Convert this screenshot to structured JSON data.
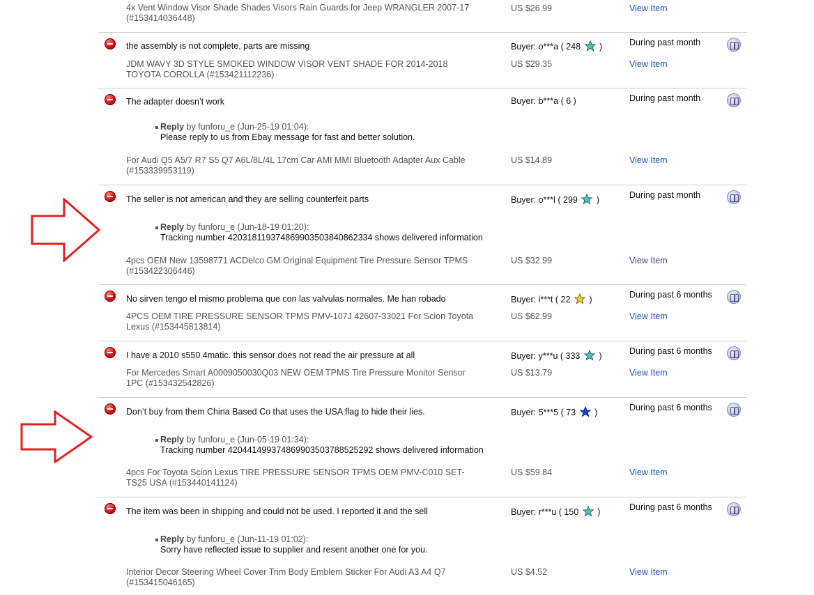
{
  "rows": [
    {
      "comment": "",
      "buyer": "",
      "period": "",
      "item_title_line1": "4x Vent Window Visor Shade Shades Visors Rain Guards for Jeep WRANGLER 2007-17",
      "item_title_line2": "(#153414036448)",
      "price": "US $26.99",
      "view": "View Item"
    },
    {
      "comment": "the assembly is not complete, parts are missing",
      "buyer_prefix": "Buyer: o***a ( 248",
      "buyer_suffix": ")",
      "star_color": "#40c8b8",
      "period": "During past month",
      "item_title_line1": "JDM WAVY 3D STYLE SMOKED WINDOW VISOR VENT SHADE FOR 2014-2018",
      "item_title_line2": "TOYOTA COROLLA (#153421112236)",
      "price": "US $29.35",
      "view": "View Item"
    },
    {
      "comment": "The adapter doesn’t work",
      "buyer_prefix": "Buyer: b***a ( 6 )",
      "period": "During past month",
      "reply_label": "Reply",
      "reply_meta": " by funforu_e (Jun-25-19 01:04):",
      "reply_text": "Please reply to us from Ebay message for fast and better solution.",
      "item_title_line1": "For Audi Q5 A5/7 R7 S5 Q7 A6L/8L/4L 17cm Car AMI MMI Bluetooth Adapter Aux Cable",
      "item_title_line2": "(#153339953119)",
      "price": "US $14.89",
      "view": "View Item"
    },
    {
      "comment": "The seller is not american and they are selling counterfeit parts",
      "buyer_prefix": "Buyer: o***l ( 299",
      "buyer_suffix": ")",
      "star_color": "#40c8b8",
      "period": "During past month",
      "reply_label": "Reply",
      "reply_meta": " by funforu_e (Jun-18-19 01:20):",
      "reply_text": "Tracking number 420318119374869903503840862334 shows delivered information",
      "item_title_line1": "4pcs OEM New 13598771 ACDelco GM Original Equipment Tire Pressure Sensor TPMS",
      "item_title_line2": "(#153422306446)",
      "price": "US $32.99",
      "view": "View Item"
    },
    {
      "comment": "No sirven tengo el mismo problema que con las valvulas normales. Me han robado",
      "buyer_prefix": "Buyer: i***t ( 22",
      "buyer_suffix": ")",
      "star_color": "#f2d21b",
      "period": "During past 6 months",
      "item_title_line1": "4PCS OEM TIRE PRESSURE SENSOR TPMS PMV-107J 42607-33021 For Scion Toyota",
      "item_title_line2": "Lexus (#153445813814)",
      "price": "US $62.99",
      "view": "View Item"
    },
    {
      "comment": "I have a 2010 s550 4matic. this sensor does not read the air pressure at all",
      "buyer_prefix": "Buyer: y***u ( 333",
      "buyer_suffix": ")",
      "star_color": "#40c8b8",
      "period": "During past 6 months",
      "item_title_line1": "For Mercedes Smart A0009050030Q03 NEW OEM TPMS Tire Pressure Monitor Sensor",
      "item_title_line2": "1PC (#153432542826)",
      "price": "US $13.79",
      "view": "View Item"
    },
    {
      "comment": "Don’t buy from them China Based Co that uses the USA flag to hide their lies.",
      "buyer_prefix": "Buyer: 5***5 ( 73",
      "buyer_suffix": ")",
      "star_color": "#1f3fd6",
      "period": "During past 6 months",
      "reply_label": "Reply",
      "reply_meta": " by funforu_e (Jun-05-19 01:34):",
      "reply_text": "Tracking number 420441499374869903503788525292 shows delivered information",
      "item_title_line1": "4pcs For Toyota Scion Lexus TIRE PRESSURE SENSOR TPMS OEM PMV-C010 SET-",
      "item_title_line2": "TS25 USA (#153440141124)",
      "price": "US $59.84",
      "view": "View Item"
    },
    {
      "comment": "The item was been in shipping and could not be used. I reported it and the sell",
      "buyer_prefix": "Buyer: r***u ( 150",
      "buyer_suffix": ")",
      "star_color": "#40c8b8",
      "period": "During past 6 months",
      "reply_label": "Reply",
      "reply_meta": " by funforu_e (Jun-11-19 01:02):",
      "reply_text": "Sorry have reflected issue to supplier and resent another one for you.",
      "item_title_line1": "Interior Decor Steering Wheel Cover Trim Body Emblem Sticker For Audi A3 A4 Q7",
      "item_title_line2": "(#153415046165)",
      "price": "US $4.52",
      "view": "View Item"
    }
  ],
  "colors": {
    "arrow": "#e02020",
    "link": "#1a55c7",
    "link_visited": "#5b3a99"
  },
  "icons": {
    "negative": "negative-feedback-icon",
    "item": "item-glyph-icon",
    "star": "feedback-star-icon",
    "annotation": "red-arrow-annotation"
  }
}
